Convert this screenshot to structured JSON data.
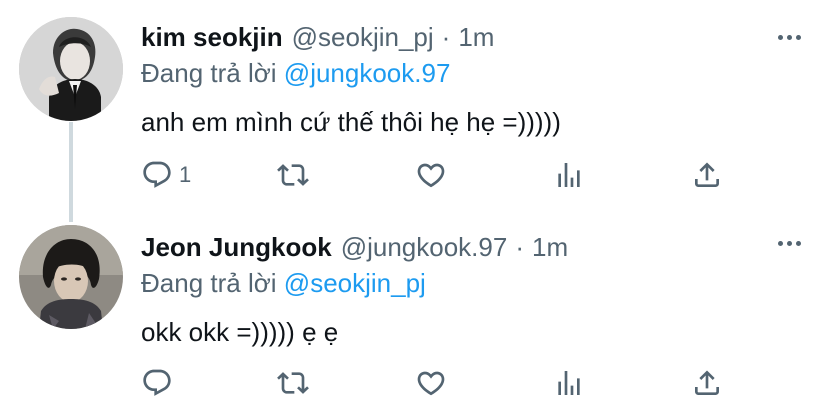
{
  "tweets": [
    {
      "name": "kim seokjin",
      "handle": "@seokjin_pj",
      "separator": "·",
      "time": "1m",
      "reply_prefix": "Đang trả lời",
      "reply_to": "@jungkook.97",
      "text": "anh em mình cứ thế thôi hẹ hẹ =)))))",
      "reply_count": "1",
      "avatar_icon": "avatar-photo"
    },
    {
      "name": "Jeon Jungkook",
      "handle": "@jungkook.97",
      "separator": "·",
      "time": "1m",
      "reply_prefix": "Đang trả lời",
      "reply_to": "@seokjin_pj",
      "text": "okk okk =))))) ẹ ẹ",
      "reply_count": "",
      "avatar_icon": "avatar-photo"
    }
  ],
  "icons": {
    "reply": "reply-icon",
    "retweet": "retweet-icon",
    "like": "heart-icon",
    "analytics": "analytics-icon",
    "share": "share-icon",
    "more": "more-icon"
  },
  "colors": {
    "accent": "#1d9bf0",
    "secondary_text": "#536471",
    "primary_text": "#0f1419",
    "thread_line": "#cfd9de"
  }
}
